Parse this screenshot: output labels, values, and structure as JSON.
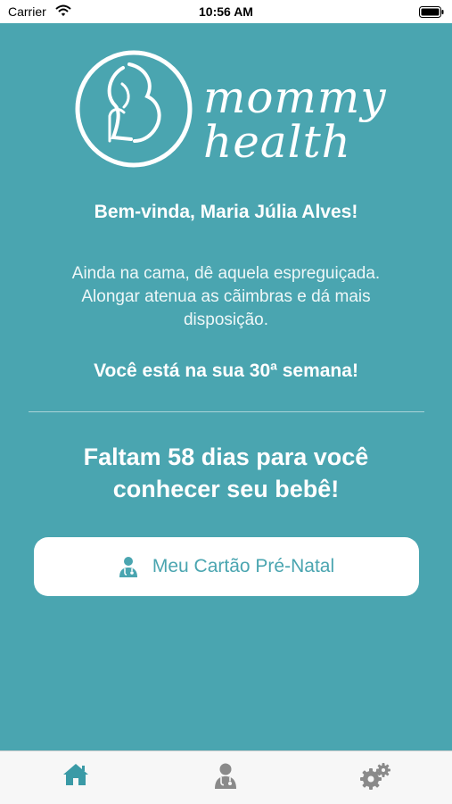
{
  "status_bar": {
    "carrier": "Carrier",
    "time": "10:56 AM"
  },
  "logo": {
    "line1": "mommy",
    "line2": "health"
  },
  "welcome": "Bem-vinda, Maria Júlia Alves!",
  "tip": "Ainda na cama, dê aquela espreguiçada. Alongar atenua as cãimbras e dá mais disposição.",
  "week": "Você está na sua 30ª semana!",
  "countdown": "Faltam 58 dias para você conhecer seu bebê!",
  "card_button": {
    "label": "Meu Cartão Pré-Natal",
    "icon": "doctor-icon"
  },
  "tab_bar": {
    "tabs": [
      {
        "icon": "home-icon",
        "active": true
      },
      {
        "icon": "doctor-icon",
        "active": false
      },
      {
        "icon": "gears-icon",
        "active": false
      }
    ]
  },
  "colors": {
    "background": "#4aa5b0",
    "accent": "#3a9aa6",
    "inactive_tab": "#8a8a8a"
  }
}
